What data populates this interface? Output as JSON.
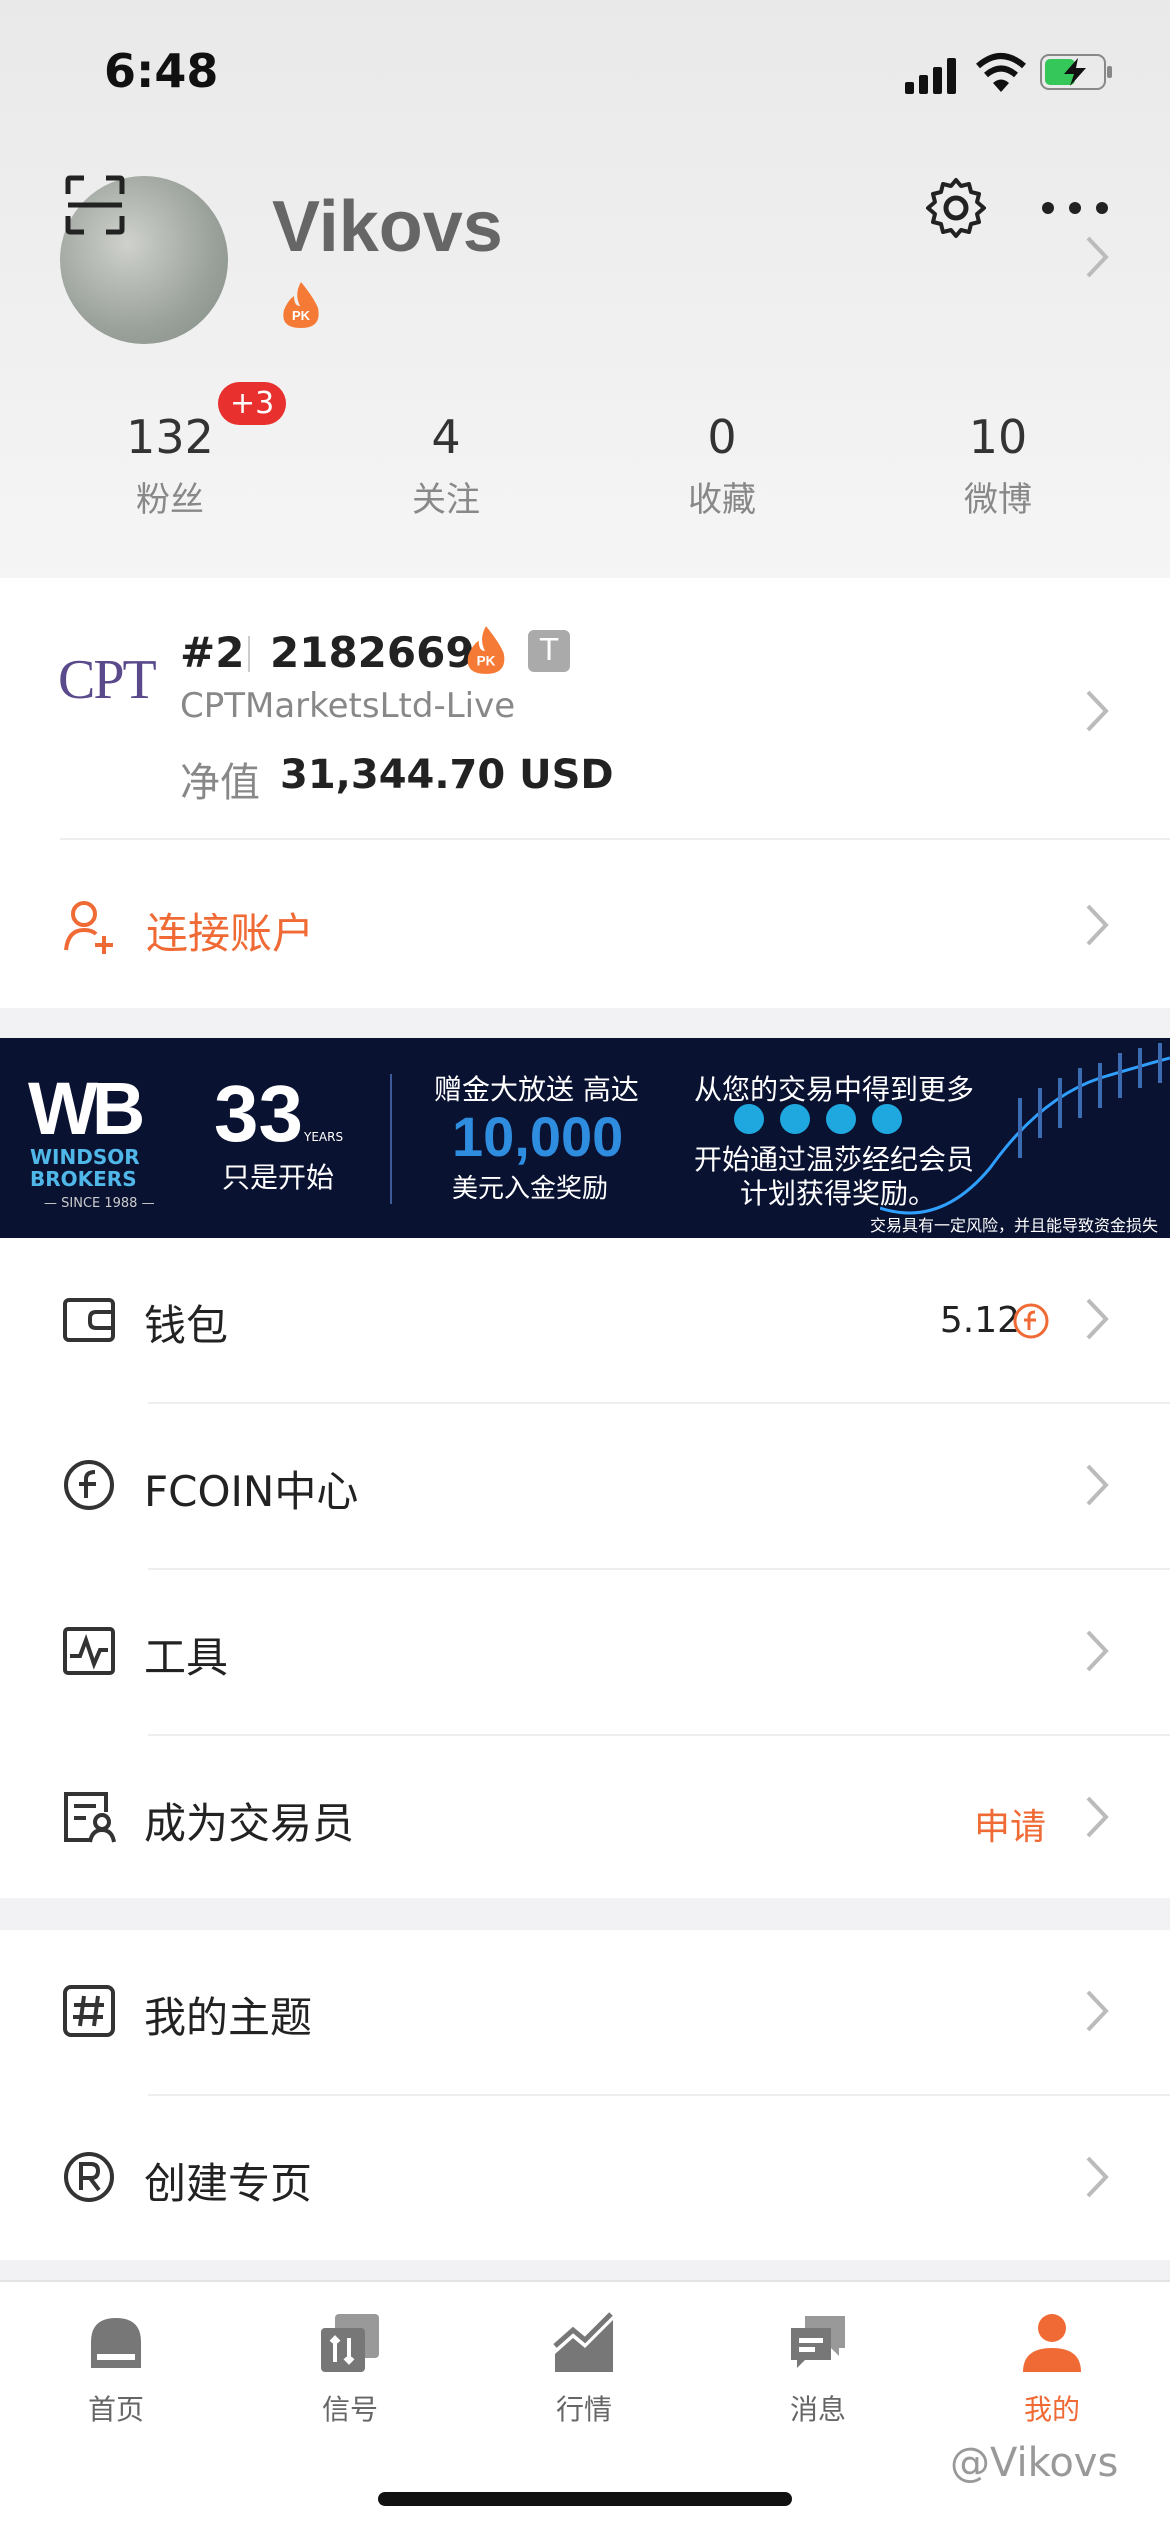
{
  "status_bar": {
    "time": "6:48"
  },
  "profile": {
    "username": "Vikovs",
    "stats": [
      {
        "value": "132",
        "label": "粉丝",
        "badge": "+3"
      },
      {
        "value": "4",
        "label": "关注"
      },
      {
        "value": "0",
        "label": "收藏"
      },
      {
        "value": "10",
        "label": "微博"
      }
    ]
  },
  "account": {
    "broker_logo": "CPT",
    "rank": "#2",
    "number": "2182669",
    "type_badge": "T",
    "broker": "CPTMarketsLtd-Live",
    "equity_label": "净值",
    "equity_value": "31,344.70 USD",
    "connect_label": "连接账户"
  },
  "banner": {
    "logo": "WB",
    "brand": "WINDSOR BROKERS",
    "since": "— SINCE 1988 —",
    "anniv": "33",
    "years": "YEARS",
    "start": "只是开始",
    "gift": "赠金大放送 高达",
    "amount": "10,000",
    "deposit": "美元入金奖励",
    "more": "从您的交易中得到更多",
    "join": "开始通过温莎经纪会员",
    "plan": "计划获得奖励。",
    "risk": "交易具有一定风险，并且能导致资金损失"
  },
  "menu": [
    {
      "label": "钱包",
      "icon": "wallet-icon",
      "right": "5.12"
    },
    {
      "label": "FCOIN中心",
      "icon": "fcoin-icon"
    },
    {
      "label": "工具",
      "icon": "tools-icon"
    },
    {
      "label": "成为交易员",
      "icon": "trader-icon",
      "right": "申请"
    }
  ],
  "menu2": [
    {
      "label": "我的主题",
      "icon": "hashtag-icon"
    },
    {
      "label": "创建专页",
      "icon": "registered-icon"
    }
  ],
  "tabs": [
    {
      "label": "首页",
      "icon": "home-icon"
    },
    {
      "label": "信号",
      "icon": "signal-icon"
    },
    {
      "label": "行情",
      "icon": "market-icon"
    },
    {
      "label": "消息",
      "icon": "message-icon"
    },
    {
      "label": "我的",
      "icon": "profile-icon",
      "active": true
    }
  ],
  "watermark": "@Vikovs",
  "colors": {
    "accent": "#f06a35",
    "badge": "#e8312f"
  }
}
